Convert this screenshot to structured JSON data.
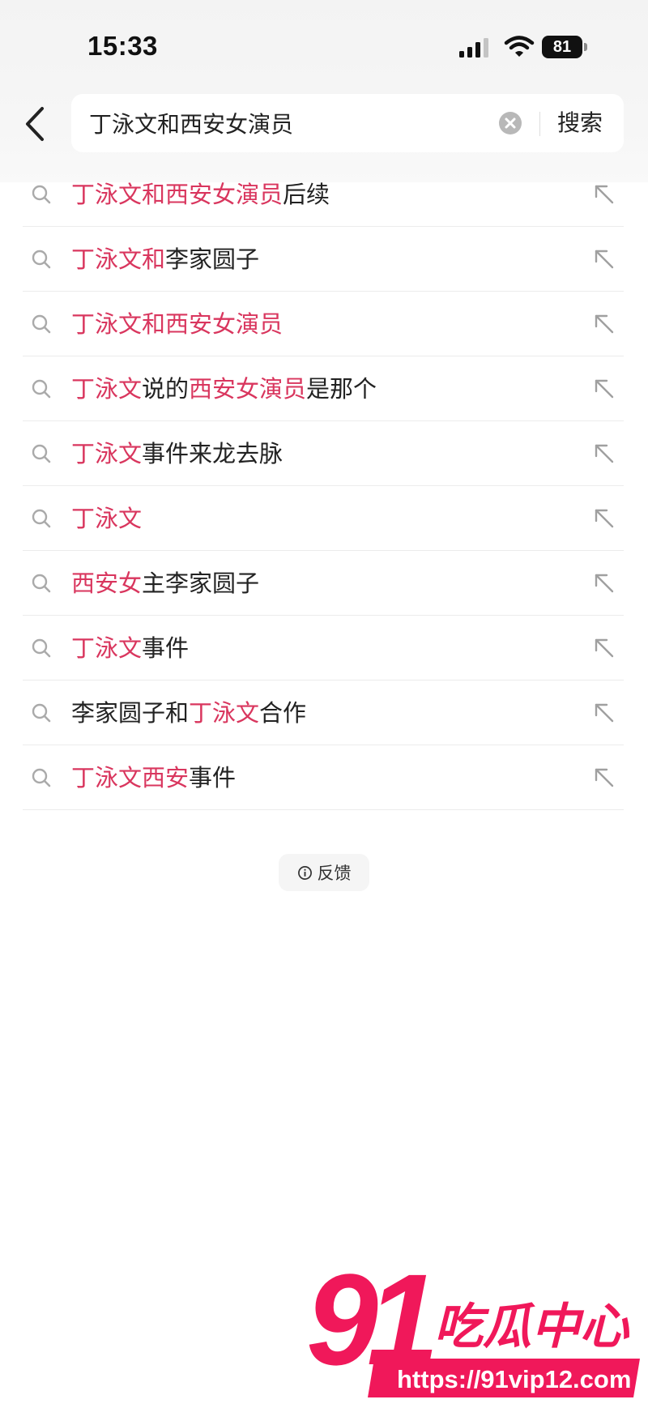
{
  "status_bar": {
    "time": "15:33",
    "battery": "81"
  },
  "search": {
    "query": "丁泳文和西安女演员",
    "submit_label": "搜索"
  },
  "suggestions": [
    {
      "parts": [
        {
          "t": "丁泳文和西安女演员",
          "hl": true
        },
        {
          "t": "后续",
          "hl": false
        }
      ]
    },
    {
      "parts": [
        {
          "t": "丁泳文和",
          "hl": true
        },
        {
          "t": "李家圆子",
          "hl": false
        }
      ]
    },
    {
      "parts": [
        {
          "t": "丁泳文和西安女演员",
          "hl": true
        }
      ]
    },
    {
      "parts": [
        {
          "t": "丁泳文",
          "hl": true
        },
        {
          "t": "说的",
          "hl": false
        },
        {
          "t": "西安女演员",
          "hl": true
        },
        {
          "t": "是那个",
          "hl": false
        }
      ]
    },
    {
      "parts": [
        {
          "t": "丁泳文",
          "hl": true
        },
        {
          "t": "事件来龙去脉",
          "hl": false
        }
      ]
    },
    {
      "parts": [
        {
          "t": "丁泳文",
          "hl": true
        }
      ]
    },
    {
      "parts": [
        {
          "t": "西安女",
          "hl": true
        },
        {
          "t": "主李家圆子",
          "hl": false
        }
      ]
    },
    {
      "parts": [
        {
          "t": "丁泳文",
          "hl": true
        },
        {
          "t": "事件",
          "hl": false
        }
      ]
    },
    {
      "parts": [
        {
          "t": "李家圆子和",
          "hl": false
        },
        {
          "t": "丁泳文",
          "hl": true
        },
        {
          "t": "合作",
          "hl": false
        }
      ]
    },
    {
      "parts": [
        {
          "t": "丁泳文西安",
          "hl": true
        },
        {
          "t": "事件",
          "hl": false
        }
      ]
    }
  ],
  "feedback": {
    "label": "反馈"
  },
  "watermark": {
    "logo_number": "91",
    "logo_text": "吃瓜中心",
    "url": "https://91vip12.com"
  },
  "colors": {
    "highlight": "#d9365e",
    "watermark_red": "#f0185a"
  },
  "icons": {
    "back": "chevron-left-icon",
    "clear": "clear-circle-icon",
    "suggestion": "search-icon",
    "fill": "arrow-up-left-icon",
    "feedback": "info-icon"
  }
}
